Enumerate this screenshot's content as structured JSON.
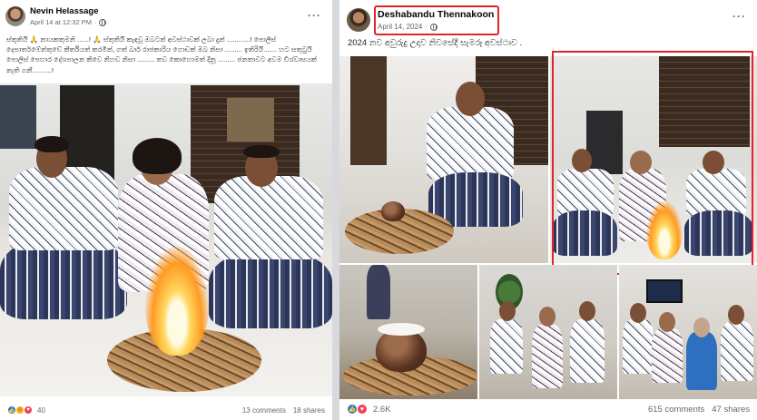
{
  "left_post": {
    "author": "Nevin Helassage",
    "timestamp": "April 14 at 12:32 PM",
    "caption": "ස්තූතියි 🙏 නායකතුමනි ......! 🙏 ස්තුතියි කැඳවූ ඔබටත් අවස්ථාවක් ලබා දුන් ............! පොලිස් දෙපාර්තමේන්තුවේ කීර්තියත් කරමින්, ගත් බාර් රාජකාරිය ගොඩක් ඔබ නිසා ......... ඉතිරියි....... හට සතුටුයි පොලිස් පෙහාර දේශපාලන කිවෙ නිහඩ නිසා ......... තව කොහොමත් දිනූ ......... ජනතාවට අවම විශ්වාසයක් නැති ගනී..........!",
    "reactions": "40",
    "comments": "13 comments",
    "shares": "18 shares"
  },
  "right_post": {
    "author": "Deshabandu Thennakoon",
    "timestamp": "April 14, 2024",
    "caption": "2024 නව අවුරුදු උදාව නිවසේදී සැමරූ අවස්ථාව .",
    "reactions": "2.6K",
    "comments": "615 comments",
    "shares": "47 shares"
  },
  "icons": {
    "more": "more-options-icon",
    "privacy": "globe-icon",
    "like": "like-reaction-icon",
    "love": "love-reaction-icon",
    "haha": "haha-reaction-icon"
  },
  "colors": {
    "highlight": "#e0242b",
    "like": "#1877f2",
    "love": "#f33e58"
  }
}
